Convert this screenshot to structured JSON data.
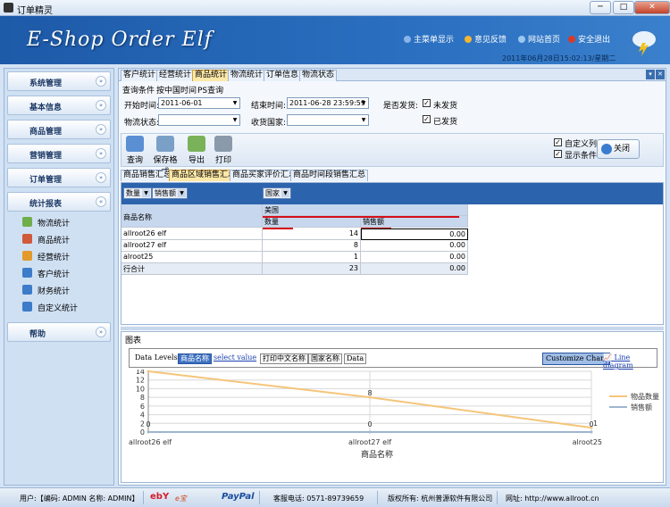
{
  "window": {
    "title": "订单精灵",
    "min": "─",
    "max": "□",
    "close": "✕"
  },
  "header": {
    "logo": "E-Shop Order Elf",
    "menu": [
      "主菜单显示",
      "意见反馈",
      "网站首页",
      "安全退出"
    ],
    "datetime": "2011年06月28日15:02:13/星期二"
  },
  "sidebar": {
    "groups": [
      {
        "label": "系统管理",
        "chev": "»"
      },
      {
        "label": "基本信息",
        "chev": "»"
      },
      {
        "label": "商品管理",
        "chev": "»"
      },
      {
        "label": "营销管理",
        "chev": "»"
      },
      {
        "label": "订单管理",
        "chev": "»"
      },
      {
        "label": "统计报表",
        "chev": "«"
      }
    ],
    "sub_items": [
      "物流统计",
      "商品统计",
      "经营统计",
      "客户统计",
      "财务统计",
      "自定义统计"
    ],
    "help": {
      "label": "帮助",
      "chev": "»"
    }
  },
  "main_tabs": [
    "客户统计",
    "经营统计",
    "商品统计",
    "物流统计",
    "订单信息",
    "物流状态"
  ],
  "tab_controls": {
    "pin": "▾",
    "close": "✕"
  },
  "query": {
    "condition_label": "查询条件",
    "sub_tabs": [
      "按中国时间",
      "PS查询"
    ],
    "start_label": "开始时间:",
    "start_value": "2011-06-01",
    "end_label": "结束时间:",
    "end_value": "2011-06-28 23:59:59",
    "shipped_label": "是否发货:",
    "unshipped": "未发货",
    "shipped": "已发货",
    "logistics_label": "物流状态:",
    "logistics_value": "",
    "country_label": "收货国家:",
    "country_value": ""
  },
  "toolbar": {
    "query": "查询",
    "save_format": "保存格式",
    "export": "导出",
    "print": "打印",
    "custom_cols": "自定义列",
    "show_conditions": "显示条件",
    "close": "关闭"
  },
  "sub_tabs": [
    "商品销售汇总",
    "商品区域销售汇总",
    "商品买家评价汇总",
    "商品时间段销售汇总"
  ],
  "pivot": {
    "data_fields": [
      "数量",
      "销售额"
    ],
    "column_field": "国家",
    "row_field": "商品名称",
    "country": "美国",
    "col_qty": "数量",
    "col_amount": "销售额",
    "rows": [
      {
        "name": "allroot26 elf",
        "qty": "14",
        "amount": "0.00"
      },
      {
        "name": "allroot27 elf",
        "qty": "8",
        "amount": "0.00"
      },
      {
        "name": "alroot25",
        "qty": "1",
        "amount": "0.00"
      }
    ],
    "total": {
      "name": "行合计",
      "qty": "23",
      "amount": "0.00"
    }
  },
  "chart_panel": {
    "title": "图表",
    "levels_label": "Data Levels:",
    "levels": [
      "商品名称",
      "select value",
      "打印中文名称",
      "国家名称",
      "Data"
    ],
    "customize": "Customize Chart",
    "line_diagram": "Line diagram"
  },
  "chart_data": {
    "type": "line",
    "categories": [
      "allroot26 elf",
      "allroot27 elf",
      "alroot25"
    ],
    "series": [
      {
        "name": "物品数量",
        "values": [
          14,
          8,
          1
        ],
        "color": "#f5c57a"
      },
      {
        "name": "销售额",
        "values": [
          0,
          0,
          0
        ],
        "color": "#9fb6cf"
      }
    ],
    "data_labels_qty": [
      "14",
      "8",
      "1"
    ],
    "data_labels_amt": [
      "0",
      "0",
      "0"
    ],
    "xlabel": "商品名称",
    "ylim": [
      0,
      14
    ],
    "yticks": [
      "0",
      "2",
      "4",
      "6",
      "8",
      "10",
      "12",
      "14"
    ],
    "grid": true,
    "legend": "right"
  },
  "status": {
    "user": "用户:【编码: ADMIN 名称: ADMIN】",
    "phone": "客服电话: 0571-89739659",
    "copyright": "版权所有: 杭州普源软件有限公司",
    "website": "网址: http://www.allroot.cn",
    "logos": [
      "ebY",
      "e宝",
      "PayPal"
    ]
  }
}
